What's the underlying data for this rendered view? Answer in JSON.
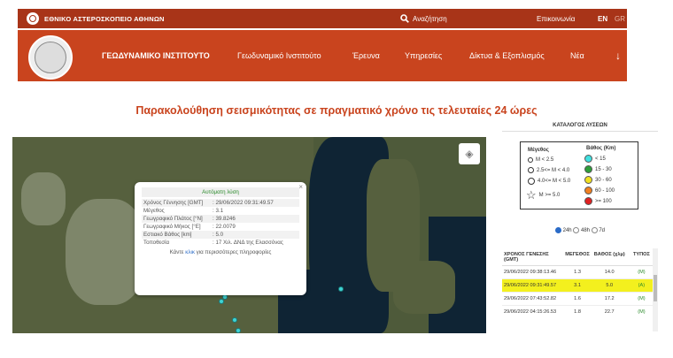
{
  "topbar": {
    "org": "ΕΘΝΙΚΟ ΑΣΤΕΡΟΣΚΟΠΕΙΟ ΑΘΗΝΩΝ",
    "search": "Αναζήτηση",
    "contact": "Επικοινωνία",
    "lang_en": "EN",
    "lang_gr": "GR"
  },
  "navbar": {
    "institute": "ΓΕΩΔΥΝΑΜΙΚΟ ΙΝΣΤΙΤΟΥΤΟ",
    "items": [
      "Γεωδυναμικό Ινστιτούτο",
      "Έρευνα",
      "Υπηρεσίες",
      "Δίκτυα & Εξοπλισμός",
      "Νέα"
    ],
    "arrow": "↓"
  },
  "page_title": "Παρακολούθηση σεισμικότητας σε πραγματικό χρόνο τις τελευταίες 24 ώρες",
  "popup": {
    "header": "Αυτόματη λύση",
    "close": "×",
    "rows": [
      {
        "k": "Χρόνος Γέννησης [GMT]",
        "v": ": 29/06/2022 09:31:49.57"
      },
      {
        "k": "Μέγεθος",
        "v": ": 3.1"
      },
      {
        "k": "Γεωγραφικό Πλάτος [°N]",
        "v": ": 39.8246"
      },
      {
        "k": "Γεωγραφικό Μήκος [°E]",
        "v": ": 22.0079"
      },
      {
        "k": "Εστιακό Βάθος [km]",
        "v": ": 5.0"
      },
      {
        "k": "Τοποθεσία",
        "v": ": 17 Χιλ. ΔΝΔ της Ελασσόνας"
      }
    ],
    "more_pre": "Κάντε ",
    "more_link": "κλικ",
    "more_post": " για περισσότερες πληροφορίες"
  },
  "catalog": {
    "title": "ΚΑΤΑΛΟΓΟΣ ΛΥΣΕΩΝ",
    "legend": {
      "mag_header": "Μέγεθος",
      "depth_header": "Βάθος (Km)",
      "mags": [
        "M < 2.5",
        "2.5<= M < 4.0",
        "4.0<= M < 5.0",
        "M >= 5.0"
      ],
      "depths": [
        {
          "label": "< 15",
          "color": "#40e0e0"
        },
        {
          "label": "15 - 30",
          "color": "#2e9e3a"
        },
        {
          "label": "30 - 60",
          "color": "#f0e020"
        },
        {
          "label": "60 - 100",
          "color": "#f08020"
        },
        {
          "label": ">= 100",
          "color": "#e02020"
        }
      ]
    },
    "periods": [
      "24h",
      "48h",
      "7d"
    ],
    "headers": [
      "ΧΡΟΝΟΣ ΓΕΝΕΣΗΣ (GMT)",
      "ΜΕΓΕΘΟΣ",
      "ΒΑΘΟΣ (χλμ)",
      "ΤΥΠΟΣ"
    ],
    "rows": [
      {
        "time": "29/06/2022 09:38:13.46",
        "mag": "1.3",
        "depth": "14.0",
        "type": "(M)"
      },
      {
        "time": "29/06/2022 09:31:49.57",
        "mag": "3.1",
        "depth": "5.0",
        "type": "(A)"
      },
      {
        "time": "29/06/2022 07:43:52.82",
        "mag": "1.6",
        "depth": "17.2",
        "type": "(M)"
      },
      {
        "time": "29/06/2022 04:15:26.53",
        "mag": "1.8",
        "depth": "22.7",
        "type": "(M)"
      }
    ]
  }
}
